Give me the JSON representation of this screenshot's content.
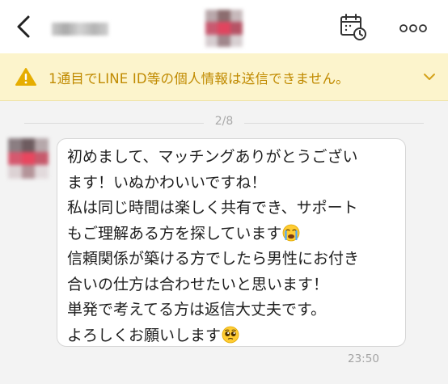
{
  "header": {
    "back_icon": "chevron-left-icon",
    "calendar_icon": "calendar-clock-icon",
    "more_icon": "more-horizontal-icon"
  },
  "warning": {
    "icon": "warning-triangle-icon",
    "text": "1通目でLINE ID等の個人情報は送信できません。",
    "chevron_icon": "chevron-down-icon",
    "color": "#c08a00",
    "background": "#fcf4cc"
  },
  "page_indicator": "2/8",
  "message": {
    "lines": [
      "初めまして、マッチングありがとうござい",
      "ます！いぬかわいいですね！",
      "私は同じ時間は楽しく共有でき、サポート",
      "もご理解ある方を探しています",
      "信頼関係が築ける方でしたら男性にお付き",
      "合いの仕方は合わせたいと思います！",
      "単発で考えてる方は返信大丈夫です。",
      "よろしくお願いします"
    ],
    "emojis": [
      "crying-face-emoji",
      "pleading-face-emoji"
    ],
    "time": "23:50"
  }
}
